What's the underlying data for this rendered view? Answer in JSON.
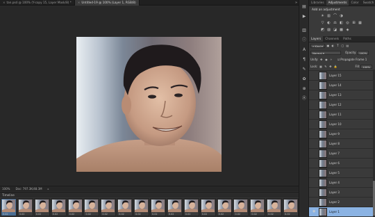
{
  "document_tabs": [
    {
      "label": "tan.psd @ 100% (Y-copy 15, Layer Mask/8) *",
      "active": false
    },
    {
      "label": "Untitled-19 @ 100% (Layer 1, RGB/8)",
      "active": true
    }
  ],
  "statusbar": {
    "zoom": "100%",
    "doc_info": "Doc: 797.3K/48.3M"
  },
  "timeline": {
    "title": "Timeline",
    "frame_delay": "0.02",
    "frame_count": 18
  },
  "adjustments_panel": {
    "tabs": [
      "Libraries",
      "Adjustments",
      "Color",
      "Swatch"
    ],
    "active_tab": "Adjustments",
    "title": "Add an adjustment",
    "row1_icons": [
      "brightness-icon",
      "levels-icon",
      "curves-icon",
      "exposure-icon"
    ],
    "row2_icons": [
      "vibrance-icon",
      "hue-icon",
      "color-balance-icon",
      "bw-icon",
      "photo-filter-icon",
      "channel-mixer-icon",
      "color-lookup-icon"
    ],
    "row3_icons": [
      "invert-icon",
      "posterize-icon",
      "threshold-icon",
      "gradient-map-icon",
      "selective-color-icon"
    ]
  },
  "layers_panel": {
    "tabs": [
      "Layers",
      "Channels",
      "Paths"
    ],
    "active_tab": "Layers",
    "filter_kind": "Kind",
    "blend_mode": "Normal",
    "opacity_label": "Opacity:",
    "opacity_value": "100%",
    "unify_label": "Unify:",
    "propagate_label": "Propagate Frame 1",
    "lock_label": "Lock:",
    "fill_label": "Fill:",
    "fill_value": "100%",
    "layers": [
      "Layer 15",
      "Layer 14",
      "Layer 13",
      "Layer 12",
      "Layer 11",
      "Layer 10",
      "Layer 9",
      "Layer 8",
      "Layer 7",
      "Layer 6",
      "Layer 5",
      "Layer 4",
      "Layer 3",
      "Layer 2",
      "Layer 1"
    ],
    "selected_layer": "Layer 1"
  },
  "colors": {
    "selection": "#8bb3e3",
    "panel_bg": "#3a3a3a",
    "canvas_bg": "#282828"
  }
}
